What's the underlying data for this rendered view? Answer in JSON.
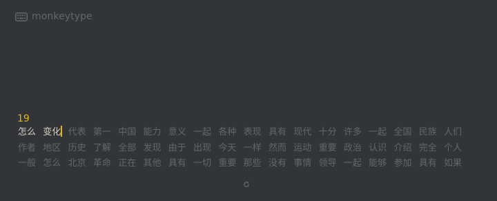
{
  "header": {
    "brand": "monkeytype",
    "logo_icon": "keyboard-icon"
  },
  "test": {
    "counter": "19",
    "current_typed": "变化",
    "current_rest": "",
    "lines": [
      [
        "怎么",
        "变化",
        "代表",
        "第一",
        "中国",
        "能力",
        "意义",
        "一起",
        "各种",
        "表现",
        "具有",
        "现代",
        "十分",
        "许多",
        "一起",
        "全国",
        "民族",
        "人们"
      ],
      [
        "作者",
        "地区",
        "历史",
        "了解",
        "全部",
        "发现",
        "由于",
        "出现",
        "今天",
        "一样",
        "然而",
        "运动",
        "重要",
        "政治",
        "认识",
        "介绍",
        "完全",
        "个人"
      ],
      [
        "一般",
        "怎么",
        "北京",
        "革命",
        "正在",
        "其他",
        "具有",
        "一切",
        "重要",
        "那些",
        "没有",
        "事情",
        "领导",
        "一起",
        "能够",
        "参加",
        "具有",
        "如果"
      ]
    ]
  },
  "controls": {
    "restart_icon": "restart-icon"
  },
  "colors": {
    "background": "#323437",
    "main": "#e2b714",
    "caret": "#e2b714",
    "sub": "#646669",
    "text": "#d1d0c5"
  }
}
